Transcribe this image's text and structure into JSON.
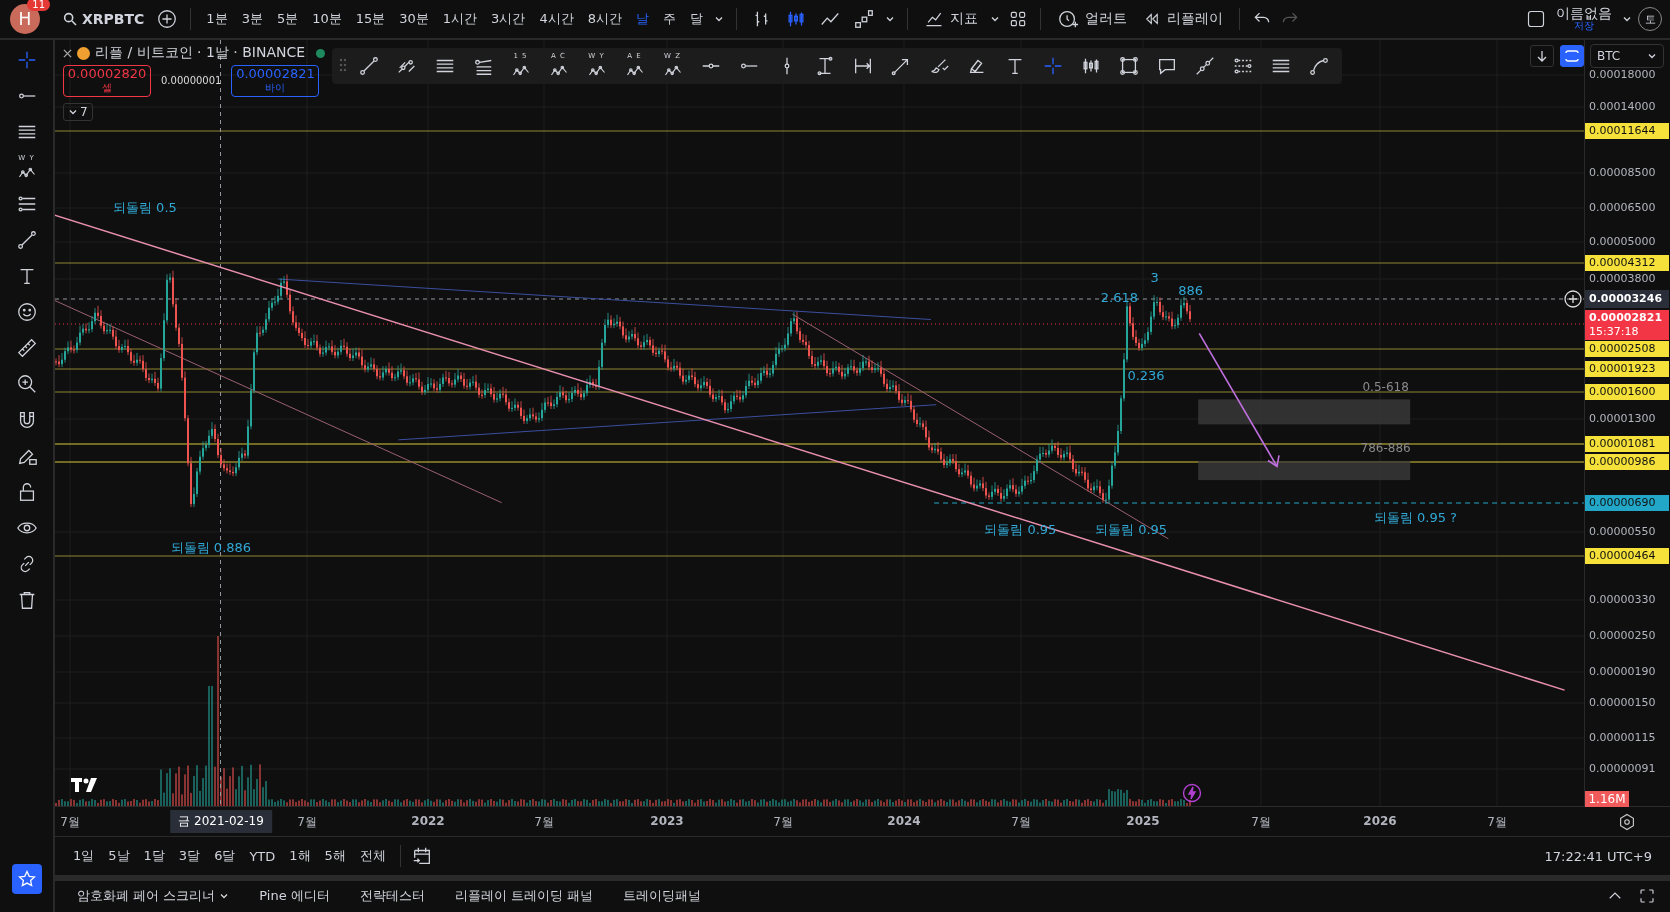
{
  "top_bar": {
    "avatar": "H",
    "notification_count": "11",
    "symbol": "XRPBTC",
    "intervals": [
      {
        "label": "1분",
        "selected": false
      },
      {
        "label": "3분",
        "selected": false
      },
      {
        "label": "5분",
        "selected": false
      },
      {
        "label": "10분",
        "selected": false
      },
      {
        "label": "15분",
        "selected": false
      },
      {
        "label": "30분",
        "selected": false
      },
      {
        "label": "1시간",
        "selected": false
      },
      {
        "label": "3시간",
        "selected": false
      },
      {
        "label": "4시간",
        "selected": false
      },
      {
        "label": "8시간",
        "selected": false
      },
      {
        "label": "날",
        "selected": true
      },
      {
        "label": "주",
        "selected": false
      },
      {
        "label": "달",
        "selected": false
      }
    ],
    "chart_types": [
      {
        "kind": "bars",
        "selected": false
      },
      {
        "kind": "candles",
        "selected": true
      },
      {
        "kind": "line",
        "selected": false
      },
      {
        "kind": "step",
        "selected": false
      }
    ],
    "indicators": "지표",
    "alert": "얼러트",
    "replay": "리플레이",
    "layout_name": "이름없음",
    "save": "저장",
    "user_initial": "토"
  },
  "left_toolbar": {
    "tools": [
      {
        "kind": "crosshair",
        "selected": true
      },
      {
        "kind": "horizontal-line",
        "selected": false
      },
      {
        "kind": "fib-lines",
        "selected": false
      },
      {
        "kind": "pattern",
        "letters": "W Y",
        "selected": false
      },
      {
        "kind": "fib-channel",
        "selected": false
      },
      {
        "kind": "trend-line",
        "selected": false
      },
      {
        "kind": "text",
        "selected": false
      },
      {
        "kind": "emoji",
        "selected": false
      },
      {
        "kind": "ruler",
        "selected": false
      },
      {
        "kind": "zoom-in",
        "selected": false
      },
      {
        "kind": "magnet",
        "selected": false
      },
      {
        "kind": "pencil-lock",
        "selected": false
      },
      {
        "kind": "lock",
        "selected": false
      },
      {
        "kind": "eye",
        "selected": false
      },
      {
        "kind": "link",
        "selected": false
      },
      {
        "kind": "trash",
        "selected": false
      }
    ]
  },
  "legend": {
    "title": "리플 / 비트코인 · 1날 · BINANCE",
    "sell_price": "0.00002820",
    "sell_label": "셀",
    "spread": "0.00000001",
    "buy_price": "0.00002821",
    "buy_label": "바이",
    "collapsed_count": "7"
  },
  "drawing_toolbar": {
    "tools": [
      {
        "kind": "trend-line",
        "selected": false
      },
      {
        "kind": "ray-pair",
        "selected": false
      },
      {
        "kind": "fib-lines",
        "selected": false
      },
      {
        "kind": "fib-fan",
        "selected": false
      },
      {
        "kind": "pattern",
        "letters": "1 5",
        "selected": false
      },
      {
        "kind": "pattern",
        "letters": "A C",
        "selected": false
      },
      {
        "kind": "pattern",
        "letters": "W Y",
        "selected": false
      },
      {
        "kind": "pattern",
        "letters": "A E",
        "selected": false
      },
      {
        "kind": "pattern",
        "letters": "W Z",
        "selected": false
      },
      {
        "kind": "horizontal-ray",
        "selected": false
      },
      {
        "kind": "horizontal-line",
        "selected": false
      },
      {
        "kind": "vertical-line",
        "selected": false
      },
      {
        "kind": "price-range",
        "selected": false
      },
      {
        "kind": "date-range",
        "selected": false
      },
      {
        "kind": "arrow",
        "selected": false
      },
      {
        "kind": "brush",
        "selected": false
      },
      {
        "kind": "highlighter",
        "selected": false
      },
      {
        "kind": "text",
        "selected": false
      },
      {
        "kind": "crosshair",
        "selected": true
      },
      {
        "kind": "candles",
        "selected": false
      },
      {
        "kind": "rectangle",
        "selected": false
      },
      {
        "kind": "callout",
        "selected": false
      },
      {
        "kind": "segment",
        "selected": false
      },
      {
        "kind": "fib-dotted",
        "selected": false
      },
      {
        "kind": "fib-lines",
        "selected": false
      },
      {
        "kind": "curve",
        "selected": false
      }
    ]
  },
  "chart": {
    "currency": "BTC",
    "price_labels": [
      {
        "text": "0.00018000",
        "kind": "tick"
      },
      {
        "text": "0.00014000",
        "kind": "tick"
      },
      {
        "text": "0.00011644",
        "kind": "level"
      },
      {
        "text": "0.00008500",
        "kind": "tick"
      },
      {
        "text": "0.00006500",
        "kind": "tick"
      },
      {
        "text": "0.00005000",
        "kind": "tick"
      },
      {
        "text": "0.00004312",
        "kind": "level"
      },
      {
        "text": "0.00003800",
        "kind": "tick"
      },
      {
        "text": "0.00003246",
        "kind": "crosshair"
      },
      {
        "text": "0.00002821",
        "kind": "last",
        "countdown": "15:37:18"
      },
      {
        "text": "0.00002508",
        "kind": "level"
      },
      {
        "text": "0.00001923",
        "kind": "level"
      },
      {
        "text": "0.00001600",
        "kind": "level"
      },
      {
        "text": "0.00001300",
        "kind": "tick"
      },
      {
        "text": "0.00001081",
        "kind": "level"
      },
      {
        "text": "0.00000986",
        "kind": "level"
      },
      {
        "text": "0.00000690",
        "kind": "alert"
      },
      {
        "text": "0.00000550",
        "kind": "tick"
      },
      {
        "text": "0.00000464",
        "kind": "level"
      },
      {
        "text": "0.00000330",
        "kind": "tick"
      },
      {
        "text": "0.00000250",
        "kind": "tick"
      },
      {
        "text": "0.00000190",
        "kind": "tick"
      },
      {
        "text": "0.00000150",
        "kind": "tick"
      },
      {
        "text": "0.00000115",
        "kind": "tick"
      },
      {
        "text": "0.00000091",
        "kind": "tick"
      }
    ],
    "volume_badge": "1.16M",
    "annotations": [
      {
        "text": "되돌림 0.5",
        "kind": "fib"
      },
      {
        "text": "3",
        "kind": "fib"
      },
      {
        "text": "886",
        "kind": "fib"
      },
      {
        "text": "2.618",
        "kind": "fib"
      },
      {
        "text": "0.236",
        "kind": "fib"
      },
      {
        "text": "0.5-618",
        "kind": "zone"
      },
      {
        "text": "786-886",
        "kind": "zone"
      },
      {
        "text": "되돌림 0.95 ?",
        "kind": "fib"
      },
      {
        "text": "되돌림 0.95",
        "kind": "fib"
      },
      {
        "text": "되돌림 0.95",
        "kind": "fib"
      },
      {
        "text": "되돌림 0.886",
        "kind": "fib"
      }
    ],
    "time_labels": [
      {
        "text": "7월",
        "kind": "tick"
      },
      {
        "text": "금 2021-02-19",
        "kind": "crosshair"
      },
      {
        "text": "7월",
        "kind": "tick"
      },
      {
        "text": "2022",
        "kind": "year"
      },
      {
        "text": "7월",
        "kind": "tick"
      },
      {
        "text": "2023",
        "kind": "year"
      },
      {
        "text": "7월",
        "kind": "tick"
      },
      {
        "text": "2024",
        "kind": "year"
      },
      {
        "text": "7월",
        "kind": "tick"
      },
      {
        "text": "2025",
        "kind": "year"
      },
      {
        "text": "7월",
        "kind": "tick"
      },
      {
        "text": "2026",
        "kind": "year"
      },
      {
        "text": "7월",
        "kind": "tick"
      }
    ]
  },
  "range_bar": {
    "ranges": [
      "1일",
      "5날",
      "1달",
      "3달",
      "6달",
      "YTD",
      "1해",
      "5해",
      "전체"
    ],
    "clock": "17:22:41 UTC+9"
  },
  "bottom_panel": {
    "tabs": [
      {
        "label": "암호화폐 페어 스크리너",
        "has_menu": true
      },
      {
        "label": "Pine 에디터",
        "has_menu": false
      },
      {
        "label": "전략테스터",
        "has_menu": false
      },
      {
        "label": "리플레이 트레이딩 패널",
        "has_menu": false
      },
      {
        "label": "트레이딩패널",
        "has_menu": false
      }
    ]
  }
}
